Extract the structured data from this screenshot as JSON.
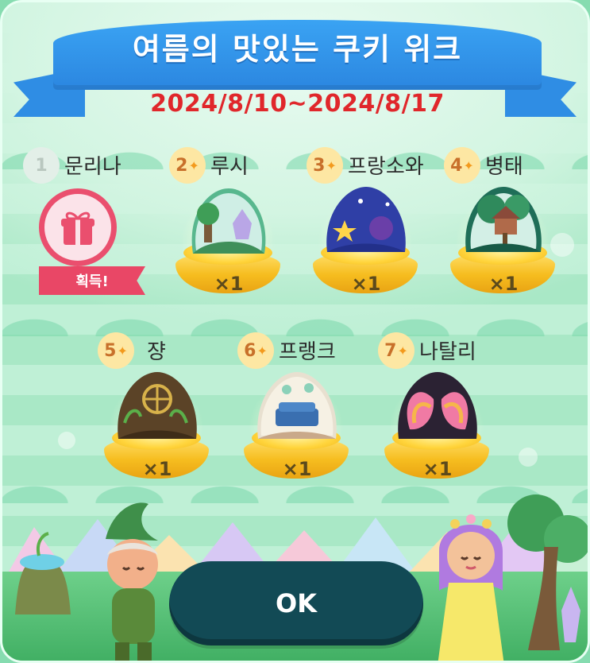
{
  "event": {
    "title": "여름의 맛있는 쿠키 위크",
    "dates": "2024/8/10~2024/8/17"
  },
  "rewards": [
    {
      "rank": "1",
      "name": "문리나",
      "status": "획득!",
      "obtained": true
    },
    {
      "rank": "2",
      "name": "루시",
      "qty": "×1",
      "icon": "forest-crystal-cookie-icon"
    },
    {
      "rank": "3",
      "name": "프랑소와",
      "qty": "×1",
      "icon": "starry-shell-cookie-icon"
    },
    {
      "rank": "4",
      "name": "병태",
      "qty": "×1",
      "icon": "treehouse-cookie-icon"
    },
    {
      "rank": "5",
      "name": "쟝",
      "qty": "×1",
      "icon": "vine-compass-cookie-icon"
    },
    {
      "rank": "6",
      "name": "프랭크",
      "qty": "×1",
      "icon": "cozy-room-cookie-icon"
    },
    {
      "rank": "7",
      "name": "나탈리",
      "qty": "×1",
      "icon": "butterfly-wing-cookie-icon"
    }
  ],
  "ok_button": {
    "label": "OK"
  },
  "colors": {
    "banner": "#2f8de4",
    "dates": "#e0272b",
    "obtained_badge": "#e94766",
    "ok_button": "#124a55",
    "pedestal": "#f6bd1f"
  }
}
